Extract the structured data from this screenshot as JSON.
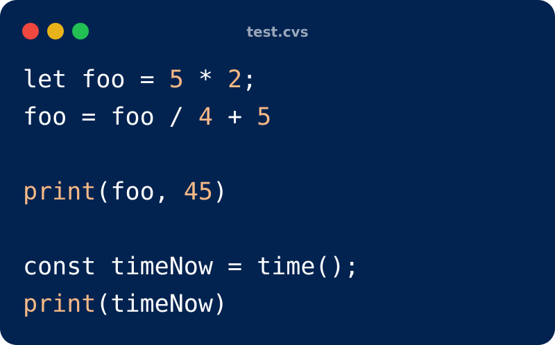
{
  "window": {
    "title": "test.cvs",
    "controls": [
      {
        "name": "close",
        "color": "#f0473f"
      },
      {
        "name": "minimize",
        "color": "#e8b31a"
      },
      {
        "name": "maximize",
        "color": "#22bf53"
      }
    ]
  },
  "colors": {
    "background": "#022350",
    "text": "#ffffff",
    "accent": "#f7b986",
    "title": "#9aa6b9"
  },
  "code": {
    "lines": [
      [
        {
          "t": "let foo = ",
          "k": "plain"
        },
        {
          "t": "5",
          "k": "num"
        },
        {
          "t": " * ",
          "k": "plain"
        },
        {
          "t": "2",
          "k": "num"
        },
        {
          "t": ";",
          "k": "plain"
        }
      ],
      [
        {
          "t": "foo = foo / ",
          "k": "plain"
        },
        {
          "t": "4",
          "k": "num"
        },
        {
          "t": " + ",
          "k": "plain"
        },
        {
          "t": "5",
          "k": "num"
        }
      ],
      [],
      [
        {
          "t": "print",
          "k": "fn"
        },
        {
          "t": "(foo, ",
          "k": "plain"
        },
        {
          "t": "45",
          "k": "num"
        },
        {
          "t": ")",
          "k": "plain"
        }
      ],
      [],
      [
        {
          "t": "const timeNow = time();",
          "k": "plain"
        }
      ],
      [
        {
          "t": "print",
          "k": "fn"
        },
        {
          "t": "(timeNow)",
          "k": "plain"
        }
      ]
    ]
  }
}
